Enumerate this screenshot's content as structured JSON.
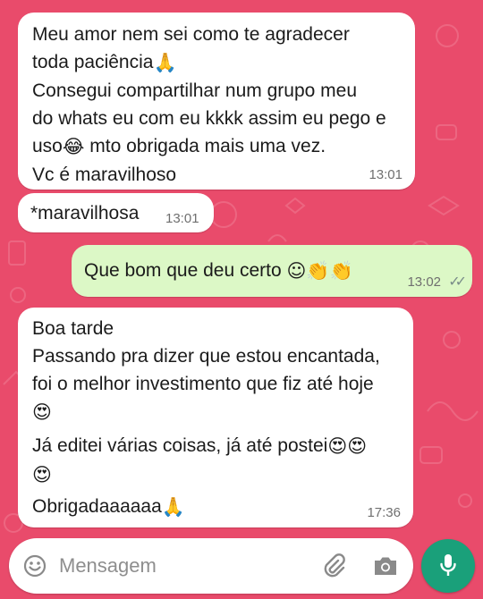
{
  "colors": {
    "wallpaper": "#e94b6b",
    "incoming_bubble": "#ffffff",
    "outgoing_bubble": "#dcf8c6",
    "mic_button": "#1aa07a"
  },
  "messages": [
    {
      "direction": "incoming",
      "lines": [
        "Meu amor nem sei como te agradecer",
        "toda paciência",
        "Consegui compartilhar num grupo meu",
        "do whats eu com eu kkkk assim eu pego e",
        "uso",
        "mto obrigada mais uma vez.",
        "Vc é maravilhoso"
      ],
      "time": "13:01"
    },
    {
      "direction": "incoming",
      "lines": [
        "*maravilhosa"
      ],
      "time": "13:01"
    },
    {
      "direction": "outgoing",
      "lines": [
        "Que bom que deu certo"
      ],
      "time": "13:02",
      "status": "read"
    },
    {
      "direction": "incoming",
      "lines": [
        "Boa tarde",
        "Passando pra dizer que estou encantada,",
        "foi o melhor investimento que fiz até hoje",
        "Já editei várias coisas, já até postei",
        "Obrigadaaaaaa"
      ],
      "time": "17:36"
    }
  ],
  "icons": {
    "pray": "folded-hands-emoji",
    "laugh": "tears-of-joy-emoji",
    "blush": "smiling-blush-emoji",
    "clap": "clapping-hands-emoji",
    "heart_eyes": "heart-eyes-emoji",
    "emoji_picker": "smiley-icon",
    "attach": "paperclip-icon",
    "camera": "camera-icon",
    "mic": "microphone-icon",
    "read_receipt": "double-check-icon"
  },
  "composer": {
    "placeholder": "Mensagem"
  }
}
